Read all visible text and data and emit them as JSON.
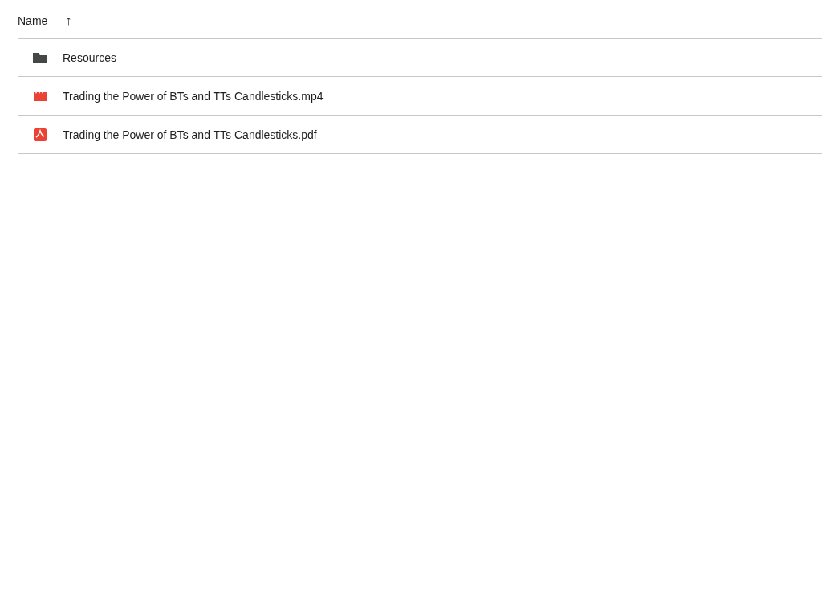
{
  "header": {
    "column": "Name",
    "sort_arrow": "↑"
  },
  "files": [
    {
      "kind": "folder",
      "name": "Resources"
    },
    {
      "kind": "video",
      "name": "Trading the Power of BTs and TTs Candlesticks.mp4"
    },
    {
      "kind": "pdf",
      "name": "Trading the Power of BTs and TTs Candlesticks.pdf"
    }
  ]
}
